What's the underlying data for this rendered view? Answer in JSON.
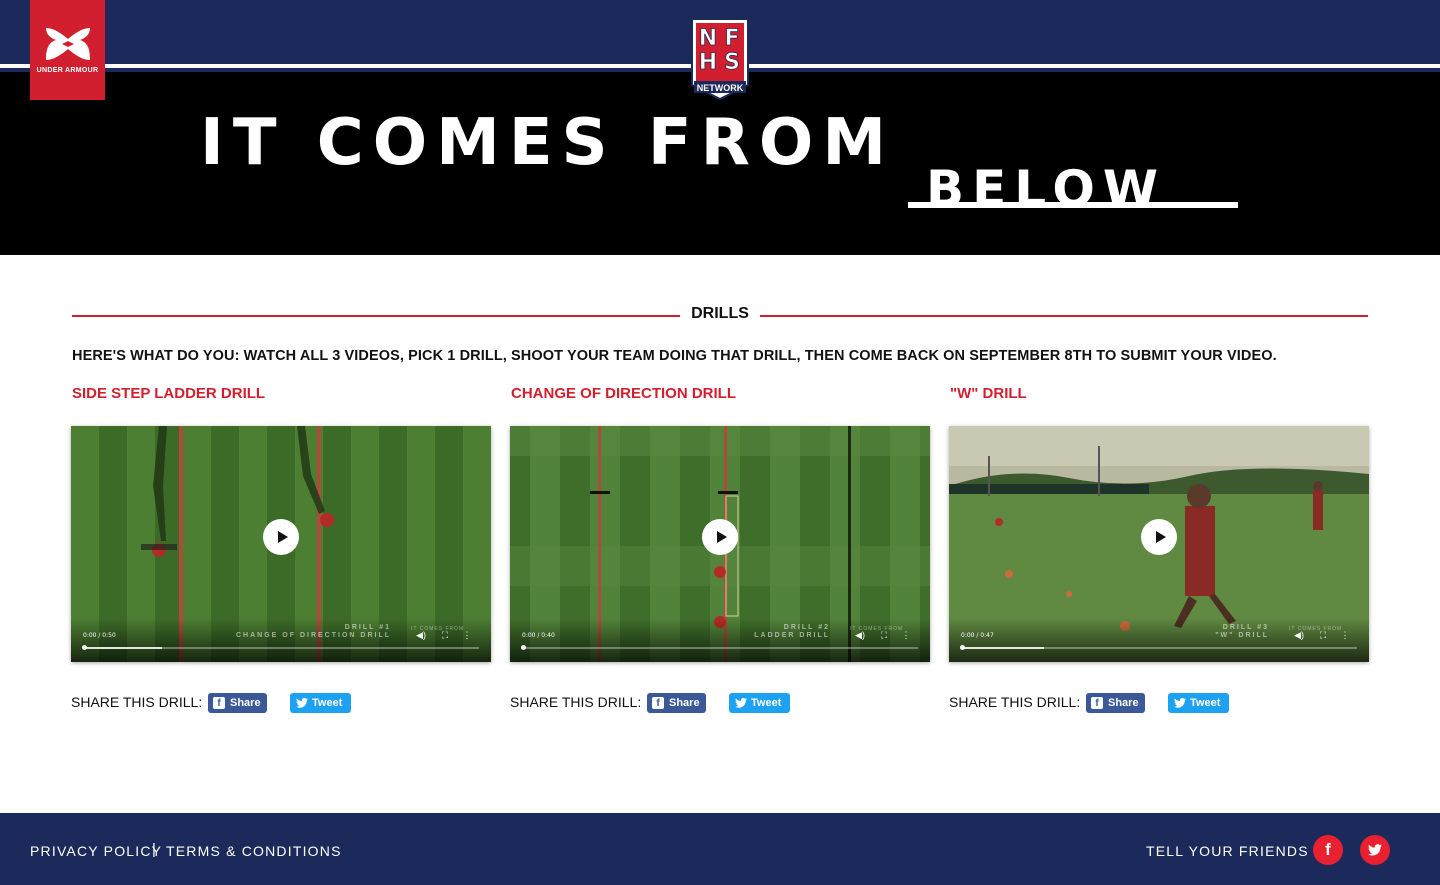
{
  "header": {
    "brand_left": "UNDER ARMOUR",
    "brand_center_letters": [
      "N",
      "F",
      "H",
      "S"
    ],
    "brand_center_sub": "NETWORK",
    "hero_line1": "IT COMES FROM",
    "hero_line2": "BELOW"
  },
  "section": {
    "title": "DRILLS",
    "instructions": "HERE'S WHAT DO YOU: WATCH ALL 3 VIDEOS, PICK 1 DRILL, SHOOT YOUR TEAM DOING THAT DRILL, THEN COME BACK ON SEPTEMBER 8TH TO SUBMIT YOUR VIDEO."
  },
  "drills": [
    {
      "title": "SIDE STEP LADDER DRILL",
      "time": "0:00 / 0:50",
      "watermark_line1": "DRILL #1",
      "watermark_line2": "CHANGE OF DIRECTION DRILL",
      "watermark_brand": "IT COMES FROM",
      "progress": 0.2,
      "share_label": "SHARE THIS DRILL:",
      "share_button": "Share",
      "tweet_button": "Tweet"
    },
    {
      "title": "CHANGE OF DIRECTION DRILL",
      "time": "0:00 / 0:40",
      "watermark_line1": "DRILL #2",
      "watermark_line2": "LADDER DRILL",
      "watermark_brand": "IT COMES FROM",
      "progress": 0.0,
      "share_label": "SHARE THIS DRILL:",
      "share_button": "Share",
      "tweet_button": "Tweet"
    },
    {
      "title": "\"W\" DRILL",
      "time": "0:00 / 0:47",
      "watermark_line1": "DRILL #3",
      "watermark_line2": "\"W\" DRILL",
      "watermark_brand": "IT COMES FROM",
      "progress": 0.21,
      "share_label": "SHARE THIS DRILL:",
      "share_button": "Share",
      "tweet_button": "Tweet"
    }
  ],
  "footer": {
    "privacy": "PRIVACY POLICY",
    "separator": "|",
    "terms": "TERMS & CONDITIONS",
    "tell_friends": "TELL YOUR FRIENDS",
    "social": [
      {
        "icon": "facebook-icon",
        "glyph": "f"
      },
      {
        "icon": "twitter-icon",
        "glyph": ""
      }
    ]
  },
  "colors": {
    "navy": "#1b2a5a",
    "accent_red": "#d21f2f",
    "facebook_blue": "#3b5998",
    "twitter_blue": "#1da1f2"
  }
}
